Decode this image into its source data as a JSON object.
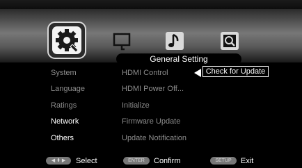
{
  "header": {
    "banner_title": "General Setting",
    "icons": [
      "system-gear-icon",
      "display-icon",
      "audio-icon",
      "parental-lock-icon"
    ]
  },
  "menu": {
    "categories": [
      {
        "label": "System",
        "active": false
      },
      {
        "label": "Language",
        "active": false
      },
      {
        "label": "Ratings",
        "active": false
      },
      {
        "label": "Network",
        "active": true
      },
      {
        "label": "Others",
        "active": true
      }
    ],
    "options": [
      {
        "label": "HDMI Control"
      },
      {
        "label": "HDMI Power Off..."
      },
      {
        "label": "Initialize"
      },
      {
        "label": "Firmware Update"
      },
      {
        "label": "Update Notification"
      }
    ],
    "popup_selected": "Check for Update"
  },
  "footer": {
    "nav_key": "◀ ⬍ ▶",
    "select_label": "Select",
    "enter_key": "ENTER",
    "confirm_label": "Confirm",
    "setup_key": "SETUP",
    "exit_label": "Exit"
  },
  "colors": {
    "background": "#000000",
    "inactive_text": "#8d8d8d",
    "active_text": "#ffffff"
  }
}
